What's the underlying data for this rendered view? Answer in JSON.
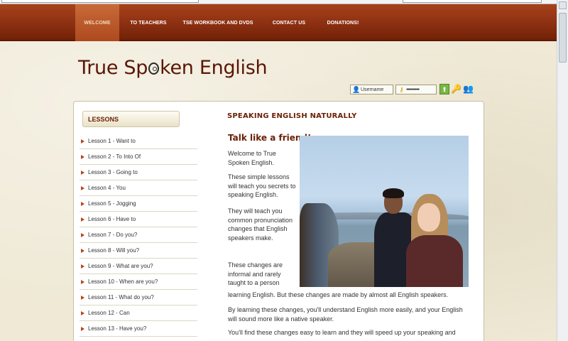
{
  "nav": {
    "items": [
      {
        "label": "WELCOME",
        "active": true
      },
      {
        "label": "TO TEACHERS",
        "active": false
      },
      {
        "label": "TSE WORKBOOK AND DVDS",
        "active": false
      },
      {
        "label": "CONTACT US",
        "active": false
      },
      {
        "label": "DONATIONS!",
        "active": false
      }
    ]
  },
  "logo": {
    "part1": "True Sp",
    "part2": "ken English"
  },
  "login": {
    "username_value": "Username",
    "password_value": "●●●●●●●●●"
  },
  "sidebar": {
    "title": "LESSONS",
    "lessons": [
      "Lesson 1 - Want to",
      "Lesson 2 - To Into Of",
      "Lesson 3 - Going to",
      "Lesson 4 - You",
      "Lesson 5 - Jogging",
      "Lesson 6 - Have to",
      "Lesson 7 - Do you?",
      "Lesson 8 - Will you?",
      "Lesson 9 - What are you?",
      "Lesson 10 - When are you?",
      "Lesson 11 - What do you?",
      "Lesson 12 - Can",
      "Lesson 13 - Have you?"
    ]
  },
  "main": {
    "title": "SPEAKING ENGLISH NATURALLY",
    "subheading": "Talk like a friend!",
    "p1": "Welcome to True Spoken English.",
    "p2": "These simple lessons will teach you secrets to speaking English.",
    "p3": "They will teach you common pronunciation changes that English speakers make.",
    "p4a": "These changes are informal and rarely taught to a person",
    "p4b": "learning English. But these changes are made by almost all English speakers.",
    "p5": "By learning these changes, you'll understand English more easily, and your English will sound more like a native speaker.",
    "p6": "You'll find these changes easy to learn and they will speed up your speaking and"
  },
  "icons": {
    "user": "user-icon",
    "key": "key-icon",
    "login": "login-arrow-icon",
    "password_help": "password-help-icon",
    "register": "register-icon"
  },
  "colors": {
    "nav_bg": "#8c3012",
    "accent": "#6a2107",
    "bullet": "#b8461c"
  }
}
